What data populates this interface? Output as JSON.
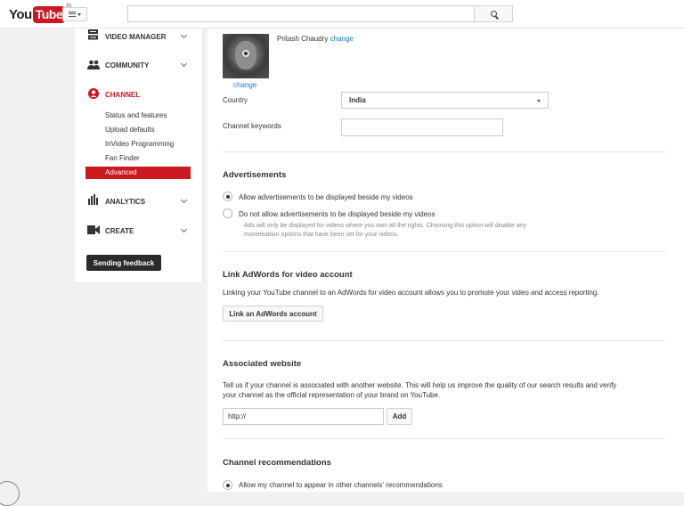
{
  "header": {
    "logo_you": "You",
    "logo_tube": "Tube",
    "logo_region": "IN",
    "search_value": ""
  },
  "sidebar": {
    "sections": {
      "video_manager": "VIDEO MANAGER",
      "community": "COMMUNITY",
      "channel": "CHANNEL",
      "analytics": "ANALYTICS",
      "create": "CREATE"
    },
    "channel_items": [
      "Status and features",
      "Upload defaults",
      "InVideo Programming",
      "Fan Finder",
      "Advanced"
    ],
    "feedback_label": "Sending feedback"
  },
  "main": {
    "account_name": "Pritash Chaudry",
    "change_label": "change",
    "avatar_change_label": "change",
    "country_label": "Country",
    "country_value": "India",
    "keywords_label": "Channel keywords",
    "keywords_value": "",
    "ads": {
      "title": "Advertisements",
      "option_allow": "Allow advertisements to be displayed beside my videos",
      "option_disallow": "Do not allow advertisements to be displayed beside my videos",
      "note_line1": "Ads will only be displayed for videos where you own all the rights. Choosing this option will disable any",
      "note_line2": "monetisation options that have been set for your videos."
    },
    "adwords": {
      "title": "Link AdWords for video account",
      "description": "Linking your YouTube channel to an AdWords for video account allows you to promote your video and access reporting.",
      "button": "Link an AdWords account"
    },
    "website": {
      "title": "Associated website",
      "description_line1": "Tell us if your channel is associated with another website. This will help us improve the quality of our search results and verify",
      "description_line2": "your channel as the official representation of your brand on YouTube.",
      "input_value": "http://",
      "add_button": "Add"
    },
    "recommendations": {
      "title": "Channel recommendations",
      "option_allow": "Allow my channel to appear in other channels' recommendations"
    }
  }
}
